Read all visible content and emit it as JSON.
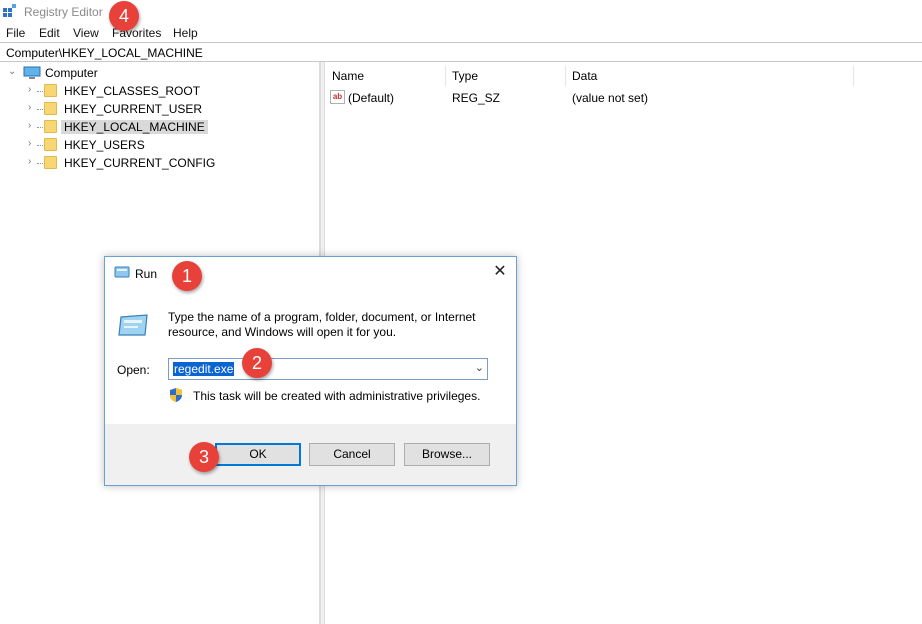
{
  "window": {
    "title": "Registry Editor",
    "menu": [
      "File",
      "Edit",
      "View",
      "Favorites",
      "Help"
    ],
    "address": "Computer\\HKEY_LOCAL_MACHINE"
  },
  "tree": {
    "root": "Computer",
    "items": [
      {
        "label": "HKEY_CLASSES_ROOT",
        "selected": false
      },
      {
        "label": "HKEY_CURRENT_USER",
        "selected": false
      },
      {
        "label": "HKEY_LOCAL_MACHINE",
        "selected": true
      },
      {
        "label": "HKEY_USERS",
        "selected": false
      },
      {
        "label": "HKEY_CURRENT_CONFIG",
        "selected": false
      }
    ]
  },
  "values": {
    "columns": [
      "Name",
      "Type",
      "Data"
    ],
    "rows": [
      {
        "name": "(Default)",
        "type": "REG_SZ",
        "data": "(value not set)",
        "icon": "string-value-icon"
      }
    ]
  },
  "run_dialog": {
    "title": "Run",
    "description": "Type the name of a program, folder, document, or Internet resource, and Windows will open it for you.",
    "open_label": "Open:",
    "open_value": "regedit.exe",
    "admin_note": "This task will be created with administrative privileges.",
    "ok_label": "OK",
    "cancel_label": "Cancel",
    "browse_label": "Browse...",
    "close_glyph": "✕"
  },
  "callouts": [
    "1",
    "2",
    "3",
    "4"
  ],
  "colors": {
    "badge": "#e8413a",
    "selection": "#0a64d1",
    "folder": "#f7d774",
    "dialog_border": "#6aa0d8"
  }
}
